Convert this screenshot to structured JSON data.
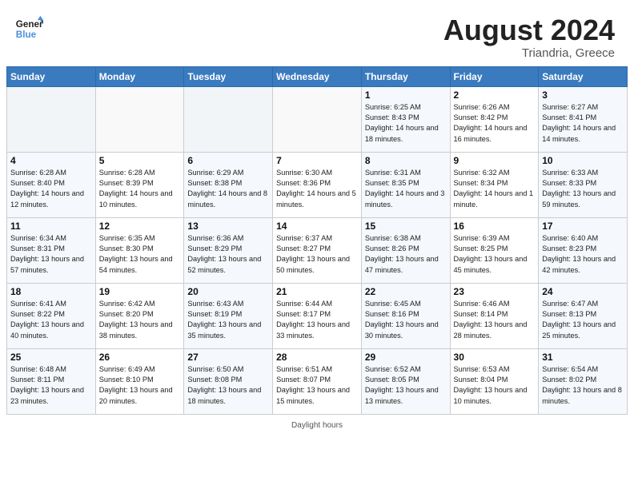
{
  "header": {
    "logo_line1": "General",
    "logo_line2": "Blue",
    "month": "August 2024",
    "location": "Triandria, Greece"
  },
  "weekdays": [
    "Sunday",
    "Monday",
    "Tuesday",
    "Wednesday",
    "Thursday",
    "Friday",
    "Saturday"
  ],
  "footer": "Daylight hours",
  "weeks": [
    [
      {
        "day": "",
        "info": ""
      },
      {
        "day": "",
        "info": ""
      },
      {
        "day": "",
        "info": ""
      },
      {
        "day": "",
        "info": ""
      },
      {
        "day": "1",
        "info": "Sunrise: 6:25 AM\nSunset: 8:43 PM\nDaylight: 14 hours\nand 18 minutes."
      },
      {
        "day": "2",
        "info": "Sunrise: 6:26 AM\nSunset: 8:42 PM\nDaylight: 14 hours\nand 16 minutes."
      },
      {
        "day": "3",
        "info": "Sunrise: 6:27 AM\nSunset: 8:41 PM\nDaylight: 14 hours\nand 14 minutes."
      }
    ],
    [
      {
        "day": "4",
        "info": "Sunrise: 6:28 AM\nSunset: 8:40 PM\nDaylight: 14 hours\nand 12 minutes."
      },
      {
        "day": "5",
        "info": "Sunrise: 6:28 AM\nSunset: 8:39 PM\nDaylight: 14 hours\nand 10 minutes."
      },
      {
        "day": "6",
        "info": "Sunrise: 6:29 AM\nSunset: 8:38 PM\nDaylight: 14 hours\nand 8 minutes."
      },
      {
        "day": "7",
        "info": "Sunrise: 6:30 AM\nSunset: 8:36 PM\nDaylight: 14 hours\nand 5 minutes."
      },
      {
        "day": "8",
        "info": "Sunrise: 6:31 AM\nSunset: 8:35 PM\nDaylight: 14 hours\nand 3 minutes."
      },
      {
        "day": "9",
        "info": "Sunrise: 6:32 AM\nSunset: 8:34 PM\nDaylight: 14 hours\nand 1 minute."
      },
      {
        "day": "10",
        "info": "Sunrise: 6:33 AM\nSunset: 8:33 PM\nDaylight: 13 hours\nand 59 minutes."
      }
    ],
    [
      {
        "day": "11",
        "info": "Sunrise: 6:34 AM\nSunset: 8:31 PM\nDaylight: 13 hours\nand 57 minutes."
      },
      {
        "day": "12",
        "info": "Sunrise: 6:35 AM\nSunset: 8:30 PM\nDaylight: 13 hours\nand 54 minutes."
      },
      {
        "day": "13",
        "info": "Sunrise: 6:36 AM\nSunset: 8:29 PM\nDaylight: 13 hours\nand 52 minutes."
      },
      {
        "day": "14",
        "info": "Sunrise: 6:37 AM\nSunset: 8:27 PM\nDaylight: 13 hours\nand 50 minutes."
      },
      {
        "day": "15",
        "info": "Sunrise: 6:38 AM\nSunset: 8:26 PM\nDaylight: 13 hours\nand 47 minutes."
      },
      {
        "day": "16",
        "info": "Sunrise: 6:39 AM\nSunset: 8:25 PM\nDaylight: 13 hours\nand 45 minutes."
      },
      {
        "day": "17",
        "info": "Sunrise: 6:40 AM\nSunset: 8:23 PM\nDaylight: 13 hours\nand 42 minutes."
      }
    ],
    [
      {
        "day": "18",
        "info": "Sunrise: 6:41 AM\nSunset: 8:22 PM\nDaylight: 13 hours\nand 40 minutes."
      },
      {
        "day": "19",
        "info": "Sunrise: 6:42 AM\nSunset: 8:20 PM\nDaylight: 13 hours\nand 38 minutes."
      },
      {
        "day": "20",
        "info": "Sunrise: 6:43 AM\nSunset: 8:19 PM\nDaylight: 13 hours\nand 35 minutes."
      },
      {
        "day": "21",
        "info": "Sunrise: 6:44 AM\nSunset: 8:17 PM\nDaylight: 13 hours\nand 33 minutes."
      },
      {
        "day": "22",
        "info": "Sunrise: 6:45 AM\nSunset: 8:16 PM\nDaylight: 13 hours\nand 30 minutes."
      },
      {
        "day": "23",
        "info": "Sunrise: 6:46 AM\nSunset: 8:14 PM\nDaylight: 13 hours\nand 28 minutes."
      },
      {
        "day": "24",
        "info": "Sunrise: 6:47 AM\nSunset: 8:13 PM\nDaylight: 13 hours\nand 25 minutes."
      }
    ],
    [
      {
        "day": "25",
        "info": "Sunrise: 6:48 AM\nSunset: 8:11 PM\nDaylight: 13 hours\nand 23 minutes."
      },
      {
        "day": "26",
        "info": "Sunrise: 6:49 AM\nSunset: 8:10 PM\nDaylight: 13 hours\nand 20 minutes."
      },
      {
        "day": "27",
        "info": "Sunrise: 6:50 AM\nSunset: 8:08 PM\nDaylight: 13 hours\nand 18 minutes."
      },
      {
        "day": "28",
        "info": "Sunrise: 6:51 AM\nSunset: 8:07 PM\nDaylight: 13 hours\nand 15 minutes."
      },
      {
        "day": "29",
        "info": "Sunrise: 6:52 AM\nSunset: 8:05 PM\nDaylight: 13 hours\nand 13 minutes."
      },
      {
        "day": "30",
        "info": "Sunrise: 6:53 AM\nSunset: 8:04 PM\nDaylight: 13 hours\nand 10 minutes."
      },
      {
        "day": "31",
        "info": "Sunrise: 6:54 AM\nSunset: 8:02 PM\nDaylight: 13 hours\nand 8 minutes."
      }
    ]
  ]
}
